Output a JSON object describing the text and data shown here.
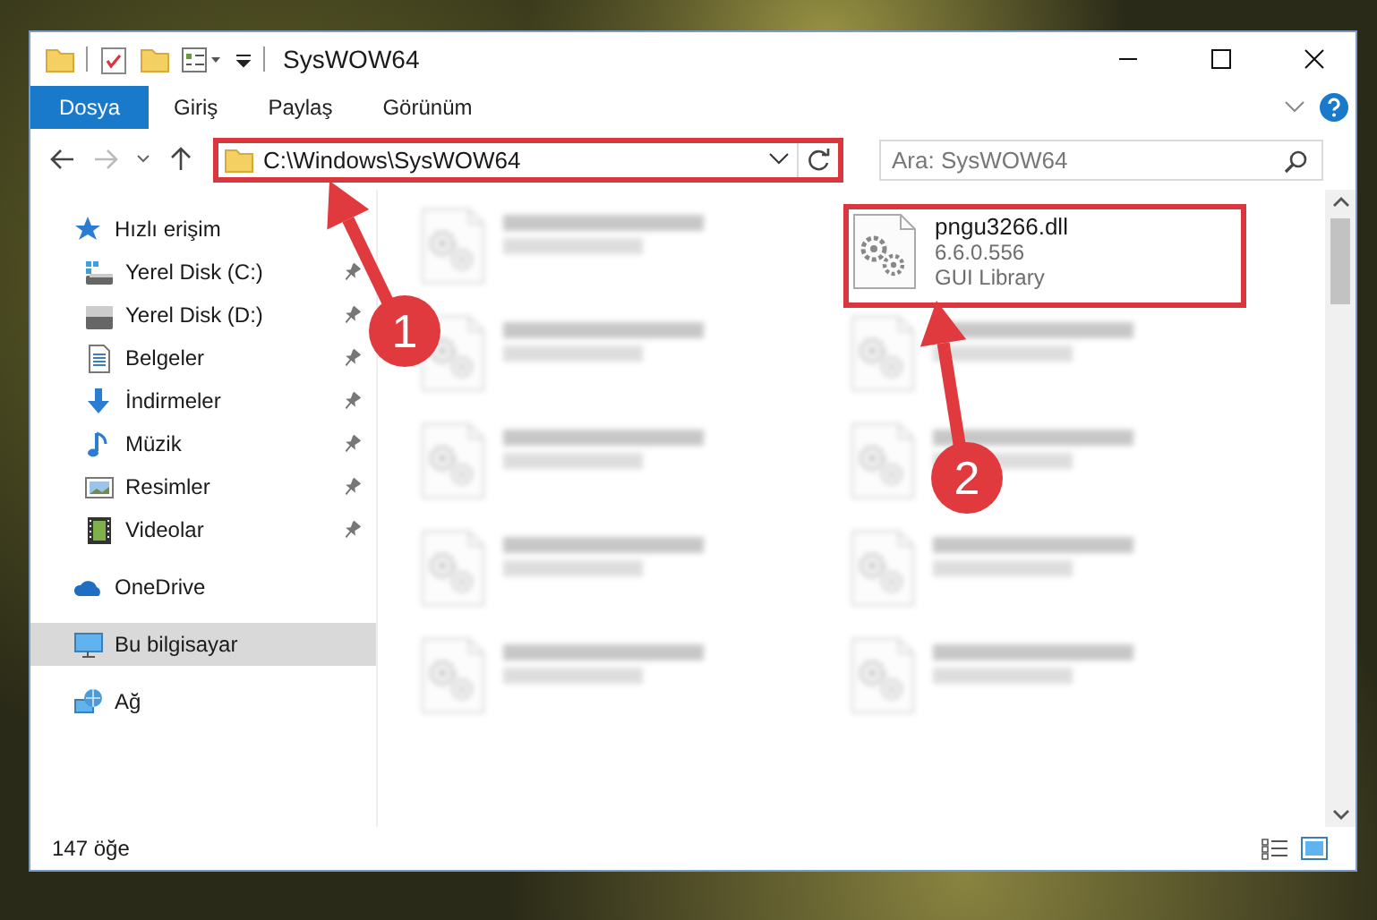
{
  "window": {
    "title": "SysWOW64"
  },
  "ribbon_tabs": [
    {
      "label": "Dosya",
      "selected": true
    },
    {
      "label": "Giriş",
      "selected": false
    },
    {
      "label": "Paylaş",
      "selected": false
    },
    {
      "label": "Görünüm",
      "selected": false
    }
  ],
  "address_bar": {
    "path": "C:\\Windows\\SysWOW64",
    "highlighted": true
  },
  "search": {
    "placeholder": "Ara: SysWOW64"
  },
  "sidebar": {
    "items": [
      {
        "label": "Hızlı erişim",
        "kind": "star",
        "selected": false,
        "children": [
          {
            "label": "Yerel Disk (C:)",
            "kind": "sysdrive",
            "pinned": true,
            "selected": false
          },
          {
            "label": "Yerel Disk (D:)",
            "kind": "drive",
            "pinned": true,
            "selected": false
          },
          {
            "label": "Belgeler",
            "kind": "document",
            "pinned": true,
            "selected": false
          },
          {
            "label": "İndirmeler",
            "kind": "download",
            "pinned": true,
            "selected": false
          },
          {
            "label": "Müzik",
            "kind": "music",
            "pinned": true,
            "selected": false
          },
          {
            "label": "Resimler",
            "kind": "picture",
            "pinned": true,
            "selected": false
          },
          {
            "label": "Videolar",
            "kind": "video",
            "pinned": true,
            "selected": false
          }
        ]
      },
      {
        "label": "OneDrive",
        "kind": "cloud",
        "selected": false
      },
      {
        "label": "Bu bilgisayar",
        "kind": "computer",
        "selected": true
      },
      {
        "label": "Ağ",
        "kind": "network",
        "selected": false
      }
    ]
  },
  "files": [
    {
      "kind": "blurred"
    },
    {
      "kind": "file",
      "name": "pngu3266.dll",
      "version": "6.6.0.556",
      "description": "GUI Library",
      "highlighted": true
    },
    {
      "kind": "blurred"
    },
    {
      "kind": "blurred"
    },
    {
      "kind": "blurred"
    },
    {
      "kind": "blurred"
    },
    {
      "kind": "blurred"
    },
    {
      "kind": "blurred"
    },
    {
      "kind": "blurred"
    },
    {
      "kind": "blurred"
    }
  ],
  "callouts": [
    {
      "label": "1"
    },
    {
      "label": "2"
    }
  ],
  "status_bar": {
    "item_count": "147 öğe"
  }
}
